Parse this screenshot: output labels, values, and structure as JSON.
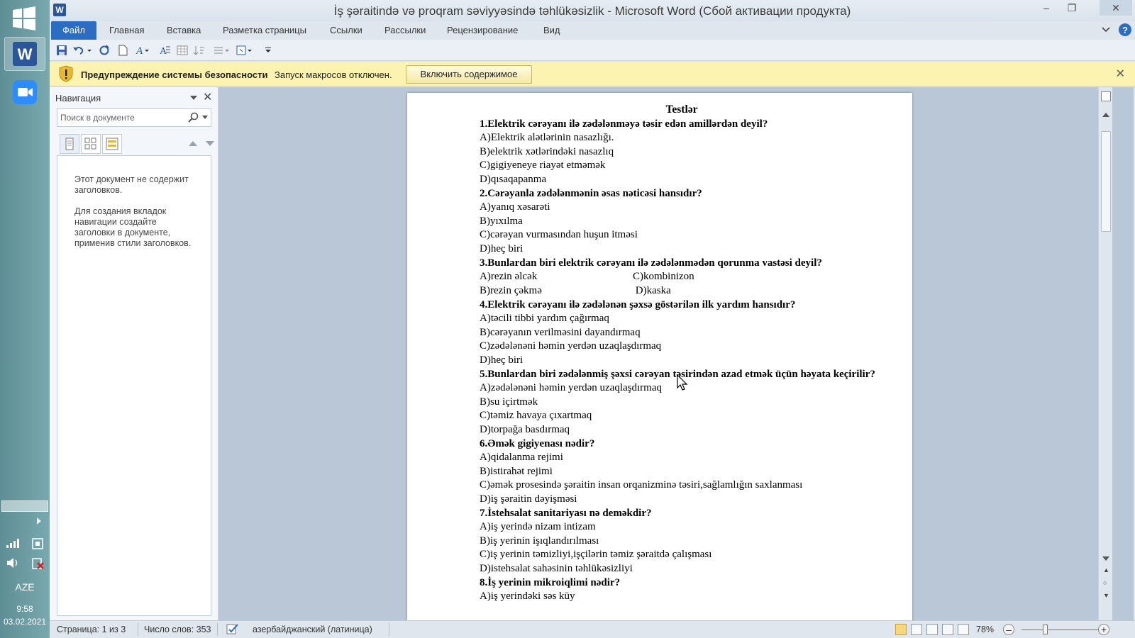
{
  "taskbar": {
    "lang": "AZE",
    "time": "9:58",
    "date": "03.02.2021"
  },
  "window": {
    "title": "İş şəraitində və proqram səviyyəsində təhlükəsizlik - Microsoft Word (Сбой активации продукта)"
  },
  "ribbon": {
    "file_tab": "Файл",
    "tabs": [
      "Главная",
      "Вставка",
      "Разметка страницы",
      "Ссылки",
      "Рассылки",
      "Рецензирование",
      "Вид"
    ]
  },
  "security_bar": {
    "title": "Предупреждение системы безопасности",
    "message": "Запуск макросов отключен.",
    "button": "Включить содержимое"
  },
  "navigation": {
    "title": "Навигация",
    "search_placeholder": "Поиск в документе",
    "empty_line1": "Этот документ не содержит заголовков.",
    "empty_line2": "Для создания вкладок навигации создайте заголовки в документе, применив стили заголовков."
  },
  "document": {
    "title": "Testlər",
    "questions": [
      {
        "q": "1.Elektrik cərəyanı  ilə zədələnməyə  təsir edən amillərdən deyil?",
        "answers": [
          "A)Elektrik alətlərinin nasazlığı.",
          "B)elektrik xətlərindəki nasazlıq",
          "C)gigiyeneye riayət etməmək",
          "D)qısaqapanma"
        ]
      },
      {
        "q": "2.Cərəyanla zədələnmənin əsas nəticəsi hansıdır?",
        "answers": [
          "A)yanıq xəsarəti",
          "B)yıxılma",
          "C)cərəyan vurmasından huşun itməsi",
          "D)heç biri"
        ]
      },
      {
        "q": "3.Bunlardan biri elektrik cərəyanı ilə zədələnmədən qorunma vastəsi deyil?",
        "answers_pairs": [
          [
            "A)rezin əlcək",
            "C)kombinizon"
          ],
          [
            "B)rezin çəkmə",
            " D)kaska"
          ]
        ]
      },
      {
        "q": "4.Elektrik cərəyanı ilə zədələnən şəxsə göstərilən ilk yardım hansıdır?",
        "answers": [
          "A)təcili tibbi yardım çağırmaq",
          "B)cərəyanın verilməsini dayandırmaq",
          "C)zədələnəni həmin yerdən uzaqlaşdırmaq",
          "D)heç biri"
        ]
      },
      {
        "q": "5.Bunlardan biri zədələnmiş şəxsi cərəyan təsirindən azad etmək  üçün həyata keçirilir?",
        "answers": [
          "A)zədələnəni həmin yerdən uzaqlaşdırmaq",
          "B)su içirtmək",
          "C)təmiz havaya çıxartmaq",
          "D)torpağa basdırmaq"
        ]
      },
      {
        "q": "6.Əmək gigiyenası nədir?",
        "answers": [
          "A)qidalanma rejimi",
          "B)istirahət rejimi",
          "C)əmək prosesində şəraitin insan orqanizminə təsiri,sağlamlığın saxlanması",
          "D)iş şəraitin dəyişməsi"
        ]
      },
      {
        "q": "7.İstehsalat sanitariyası nə deməkdir?",
        "answers": [
          "A)iş yerində nizam intizam",
          "B)iş yerinin işıqlandırılması",
          "C)iş yerinin təmizliyi,işçilərin təmiz şəraitdə çalışması",
          "D)istehsalat sahəsinin təhlükəsizliyi"
        ]
      },
      {
        "q": "8.İş yerinin mikroiqlimi nədir?",
        "answers": [
          "A)iş yerindəki səs küy"
        ]
      }
    ]
  },
  "status": {
    "page": "Страница: 1 из 3",
    "words": "Число слов: 353",
    "language": "азербайджанский (латиница)",
    "zoom": "78%"
  },
  "colors": {
    "file_tab": "#2b6cc4",
    "message_bar": "#fdf3b0",
    "doc_background": "#b9c7d6"
  }
}
